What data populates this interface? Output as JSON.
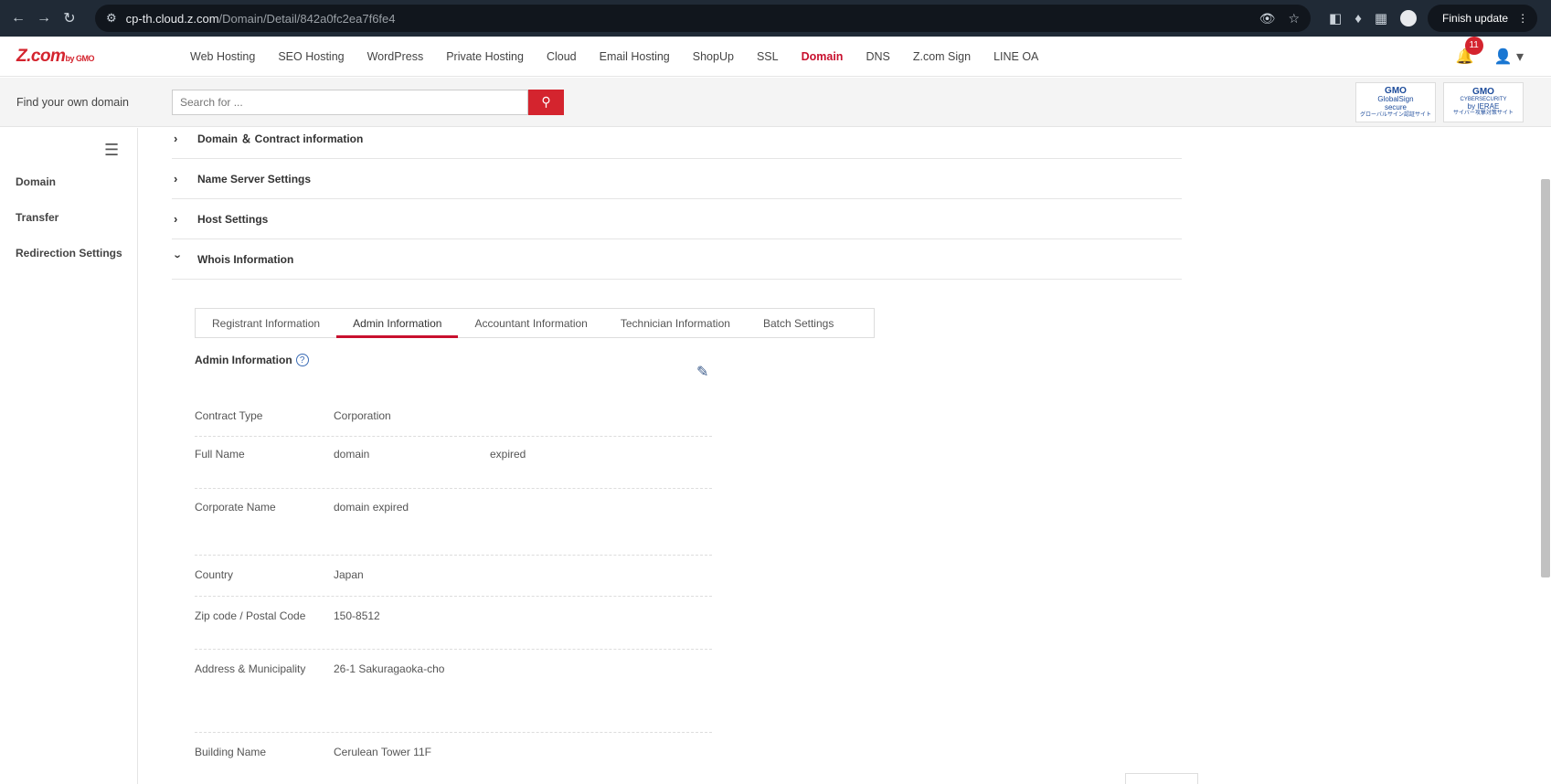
{
  "browser": {
    "url_host": "cp-th.cloud.z.com",
    "url_path": "/Domain/Detail/842a0fc2ea7f6fe4",
    "finish_update": "Finish update"
  },
  "header": {
    "logo_text": "Z.com",
    "logo_sub": "by GMO",
    "nav": [
      "Web Hosting",
      "SEO Hosting",
      "WordPress",
      "Private Hosting",
      "Cloud",
      "Email Hosting",
      "ShopUp",
      "SSL",
      "Domain",
      "DNS",
      "Z.com Sign",
      "LINE OA"
    ],
    "active_nav": "Domain",
    "notification_count": "11"
  },
  "search": {
    "label": "Find your own domain",
    "placeholder": "Search for ..."
  },
  "badges": {
    "globalsign": {
      "line1": "GMO",
      "line2": "GlobalSign",
      "line3": "secure",
      "line4": "グローバルサイン認証サイト"
    },
    "ierae": {
      "line1": "GMO",
      "line2": "CYBERSECURITY",
      "line3": "by IERAE",
      "line4": "サイバー攻撃対策サイト"
    }
  },
  "sidebar": {
    "items": [
      "Domain",
      "Transfer",
      "Redirection Settings"
    ]
  },
  "accordion": [
    {
      "title": "Domain ＆ Contract information",
      "expanded": false
    },
    {
      "title": "Name Server Settings",
      "expanded": false
    },
    {
      "title": "Host Settings",
      "expanded": false
    },
    {
      "title": "Whois Information",
      "expanded": true
    }
  ],
  "tabs": [
    "Registrant Information",
    "Admin Information",
    "Accountant Information",
    "Technician Information",
    "Batch Settings"
  ],
  "active_tab": "Admin Information",
  "section": {
    "title": "Admin Information",
    "help": "?"
  },
  "info": {
    "contract_type": {
      "label": "Contract Type",
      "value": "Corporation"
    },
    "full_name": {
      "label": "Full Name",
      "first": "domain",
      "last": "expired"
    },
    "corporate_name": {
      "label": "Corporate Name",
      "value": "domain expired"
    },
    "country": {
      "label": "Country",
      "value": "Japan"
    },
    "zip": {
      "label": "Zip code / Postal Code",
      "value": "150-8512"
    },
    "address": {
      "label": "Address & Municipality",
      "value": "26-1 Sakuragaoka-cho"
    },
    "building": {
      "label": "Building Name",
      "value": "Cerulean Tower 11F"
    }
  },
  "colors": {
    "brand": "#d4242e",
    "accent": "#c8102e"
  }
}
